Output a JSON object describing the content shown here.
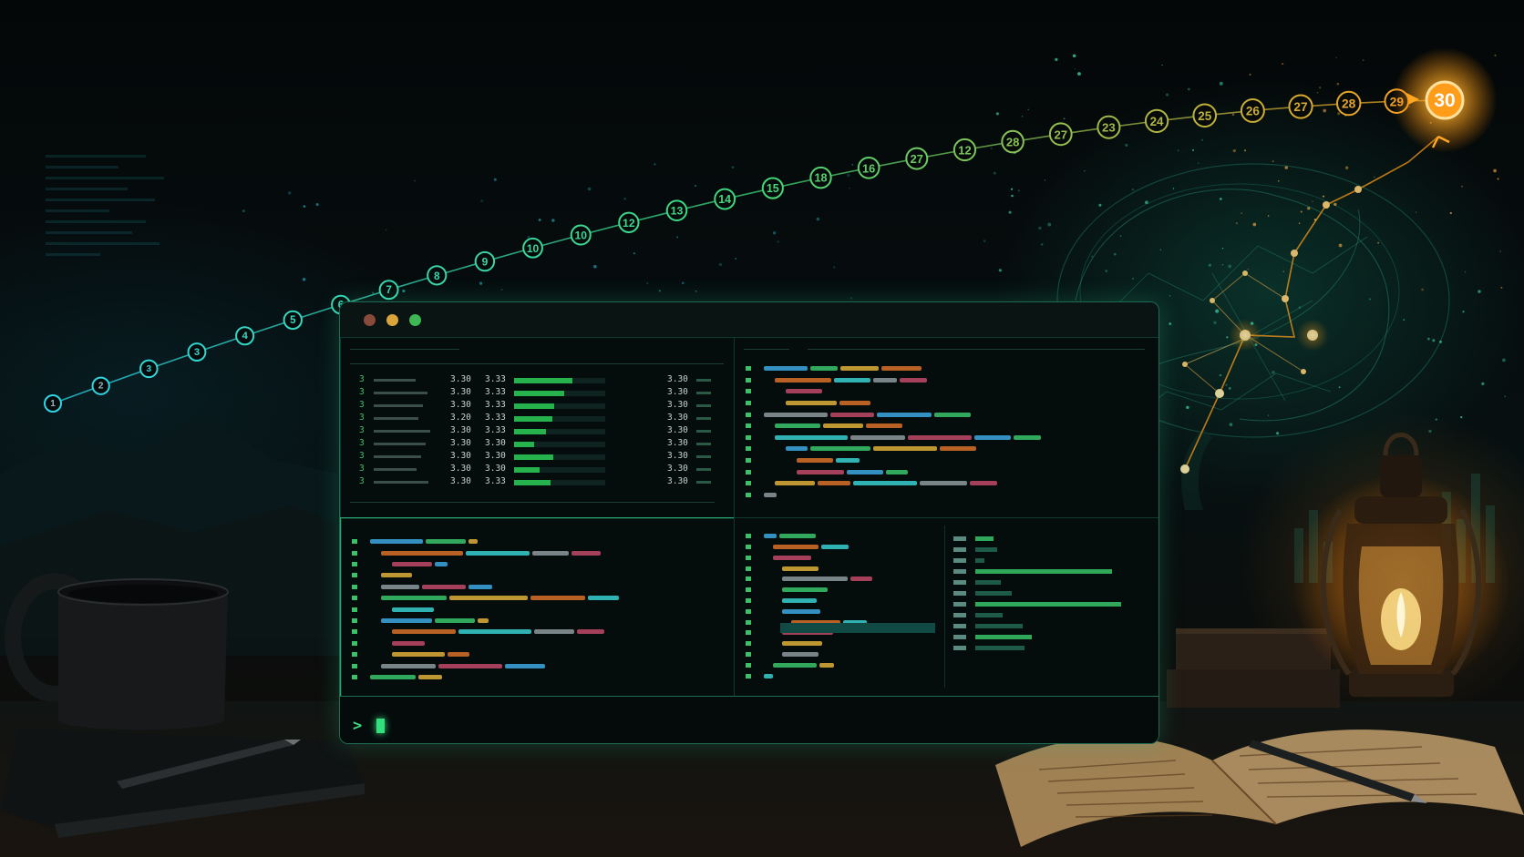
{
  "window": {
    "controls": [
      {
        "name": "close",
        "color": "#8a4a3a"
      },
      {
        "name": "minimize",
        "color": "#d9a43a"
      },
      {
        "name": "maximize",
        "color": "#3fb654"
      }
    ],
    "prompt_symbol": ">"
  },
  "colors": {
    "accent_cyan": "#2fd6e6",
    "accent_green": "#3fd87a",
    "accent_orange": "#ff9d1a",
    "bar_green": "#26b24c"
  },
  "top_left_pane": {
    "header": "",
    "rows": [
      {
        "index": "3",
        "value_a": "3.30",
        "value_b": "3.33",
        "progress": 0.64,
        "value_c": "3.30"
      },
      {
        "index": "3",
        "value_a": "3.30",
        "value_b": "3.33",
        "progress": 0.55,
        "value_c": "3.30"
      },
      {
        "index": "3",
        "value_a": "3.30",
        "value_b": "3.33",
        "progress": 0.44,
        "value_c": "3.30"
      },
      {
        "index": "3",
        "value_a": "3.20",
        "value_b": "3.33",
        "progress": 0.42,
        "value_c": "3.30"
      },
      {
        "index": "3",
        "value_a": "3.30",
        "value_b": "3.33",
        "progress": 0.35,
        "value_c": "3.30"
      },
      {
        "index": "3",
        "value_a": "3.30",
        "value_b": "3.30",
        "progress": 0.22,
        "value_c": "3.30"
      },
      {
        "index": "3",
        "value_a": "3.30",
        "value_b": "3.30",
        "progress": 0.43,
        "value_c": "3.30"
      },
      {
        "index": "3",
        "value_a": "3.30",
        "value_b": "3.30",
        "progress": 0.28,
        "value_c": "3.30"
      },
      {
        "index": "3",
        "value_a": "3.30",
        "value_b": "3.33",
        "progress": 0.4,
        "value_c": "3.30"
      }
    ]
  },
  "progression_labels": [
    "1",
    "2",
    "3",
    "3",
    "4",
    "5",
    "6",
    "7",
    "8",
    "9",
    "10",
    "10",
    "12",
    "13",
    "14",
    "15",
    "18",
    "16",
    "27",
    "12",
    "28",
    "27",
    "23",
    "24",
    "25",
    "26",
    "27",
    "28",
    "29",
    "30"
  ],
  "final_node_label": "30",
  "icons": [
    "coffee-mug-icon",
    "notebook-icon",
    "pen-icon",
    "brain-network-icon",
    "lantern-icon",
    "open-book-icon",
    "arrow-icon"
  ]
}
